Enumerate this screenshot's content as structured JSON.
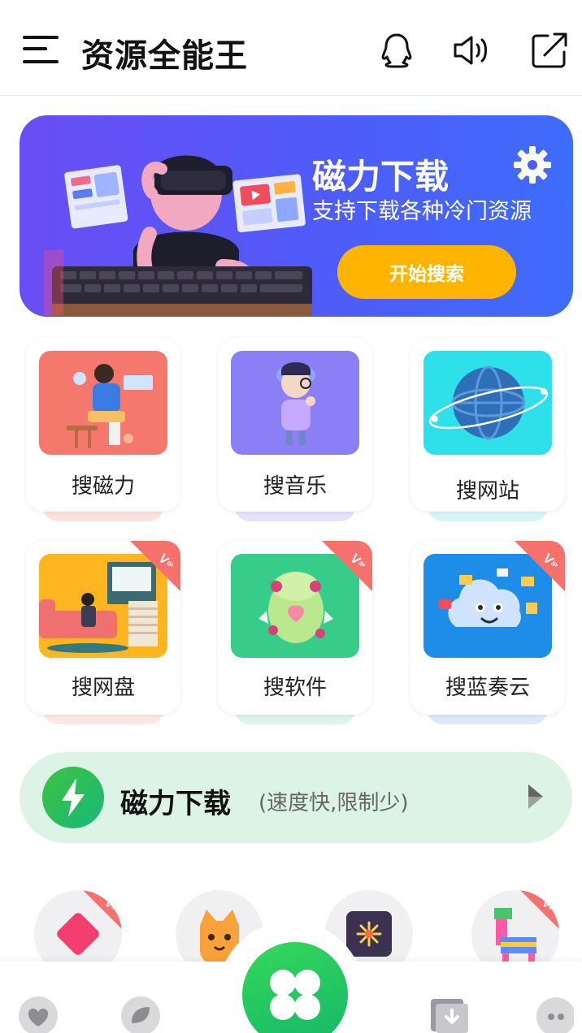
{
  "header": {
    "title": "资源全能王",
    "icons": [
      "menu-icon",
      "qq-icon",
      "volume-icon",
      "share-icon"
    ]
  },
  "banner": {
    "title": "磁力下载",
    "subtitle": "支持下载各种冷门资源",
    "button_label": "开始搜索",
    "icon": "gear-icon"
  },
  "grid": {
    "row1": [
      {
        "label": "搜磁力",
        "vip": false,
        "bg": "#f4786c"
      },
      {
        "label": "搜音乐",
        "vip": false,
        "bg": "#8b7ff5"
      },
      {
        "label": "搜网站",
        "vip": false,
        "bg": "#2ee0ea"
      }
    ],
    "row2": [
      {
        "label": "搜网盘",
        "vip": true,
        "bg": "#ffb520"
      },
      {
        "label": "搜软件",
        "vip": true,
        "bg": "#37cc8a"
      },
      {
        "label": "搜蓝奏云",
        "vip": true,
        "bg": "#1e8de8"
      }
    ],
    "vip_text": "VIP"
  },
  "magnet_bar": {
    "title": "磁力下载",
    "subtitle": "(速度快,限制少)"
  },
  "tabbar": {
    "tabs": [
      "heart-tab-icon",
      "leaf-tab-icon",
      "clover-icon",
      "download-tab-icon",
      "profile-tab-icon"
    ]
  },
  "colors": {
    "accent": "#ffb400",
    "banner_start": "#6a4df4",
    "banner_end": "#3e6cfb",
    "green": "#2fd05d",
    "magbar_bg": "#dcf3e5",
    "vip_red": "#f6706c"
  }
}
